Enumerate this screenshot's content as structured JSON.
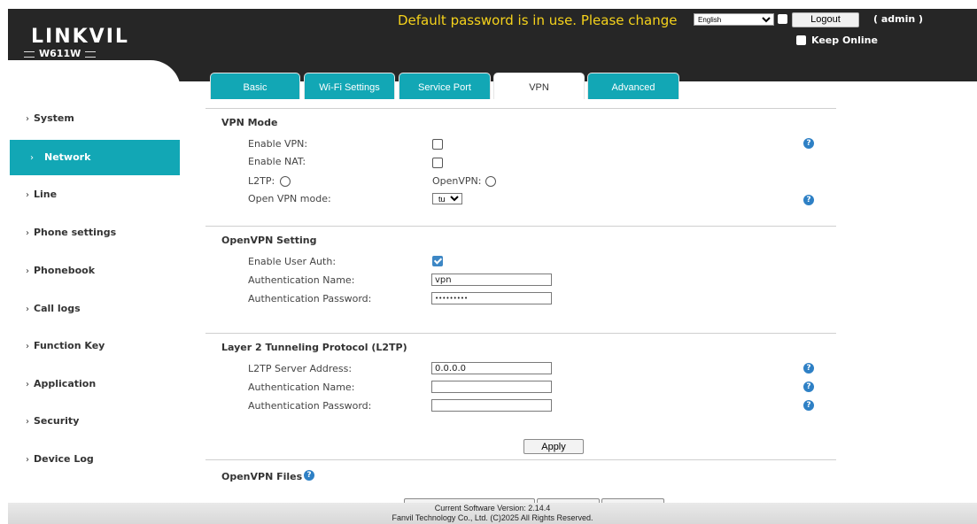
{
  "header": {
    "brand": "LINKVIL",
    "model": "W611W",
    "warning": "Default password is in use. Please change",
    "language": "English",
    "logout_label": "Logout",
    "user": "( admin )",
    "keep_online_label": "Keep Online",
    "keep_online_checked": true
  },
  "sidebar": {
    "items": [
      {
        "label": "System",
        "active": false
      },
      {
        "label": "Network",
        "active": true
      },
      {
        "label": "Line",
        "active": false
      },
      {
        "label": "Phone settings",
        "active": false
      },
      {
        "label": "Phonebook",
        "active": false
      },
      {
        "label": "Call logs",
        "active": false
      },
      {
        "label": "Function Key",
        "active": false
      },
      {
        "label": "Application",
        "active": false
      },
      {
        "label": "Security",
        "active": false
      },
      {
        "label": "Device Log",
        "active": false
      }
    ]
  },
  "tabs": [
    {
      "label": "Basic",
      "active": false
    },
    {
      "label": "Wi-Fi Settings",
      "active": false
    },
    {
      "label": "Service Port",
      "active": false
    },
    {
      "label": "VPN",
      "active": true
    },
    {
      "label": "Advanced",
      "active": false
    }
  ],
  "vpn_mode": {
    "title": "VPN Mode",
    "enable_vpn_label": "Enable VPN:",
    "enable_vpn_checked": false,
    "enable_nat_label": "Enable NAT:",
    "enable_nat_checked": false,
    "l2tp_label": "L2TP:",
    "openvpn_label": "OpenVPN:",
    "openvpn_mode_label": "Open VPN mode:",
    "openvpn_mode_value": "tun"
  },
  "openvpn_setting": {
    "title": "OpenVPN Setting",
    "enable_user_auth_label": "Enable User Auth:",
    "enable_user_auth_checked": true,
    "auth_name_label": "Authentication Name:",
    "auth_name_value": "vpn",
    "auth_password_label": "Authentication Password:",
    "auth_password_value": "•••••••••"
  },
  "l2tp": {
    "title": "Layer 2 Tunneling Protocol (L2TP)",
    "server_label": "L2TP Server Address:",
    "server_value": "0.0.0.0",
    "auth_name_label": "Authentication Name:",
    "auth_name_value": "",
    "auth_password_label": "Authentication Password:",
    "auth_password_value": ""
  },
  "apply_label": "Apply",
  "openvpn_files_title": "OpenVPN Files",
  "help_glyph": "?",
  "footer": {
    "version": "Current Software Version: 2.14.4",
    "copyright": "Fanvil Technology Co., Ltd. (C)2025 All Rights Reserved."
  },
  "colors": {
    "accent": "#12a7b5",
    "header_bg": "#262626",
    "warning": "#f5d21b",
    "help": "#2e80c5"
  }
}
